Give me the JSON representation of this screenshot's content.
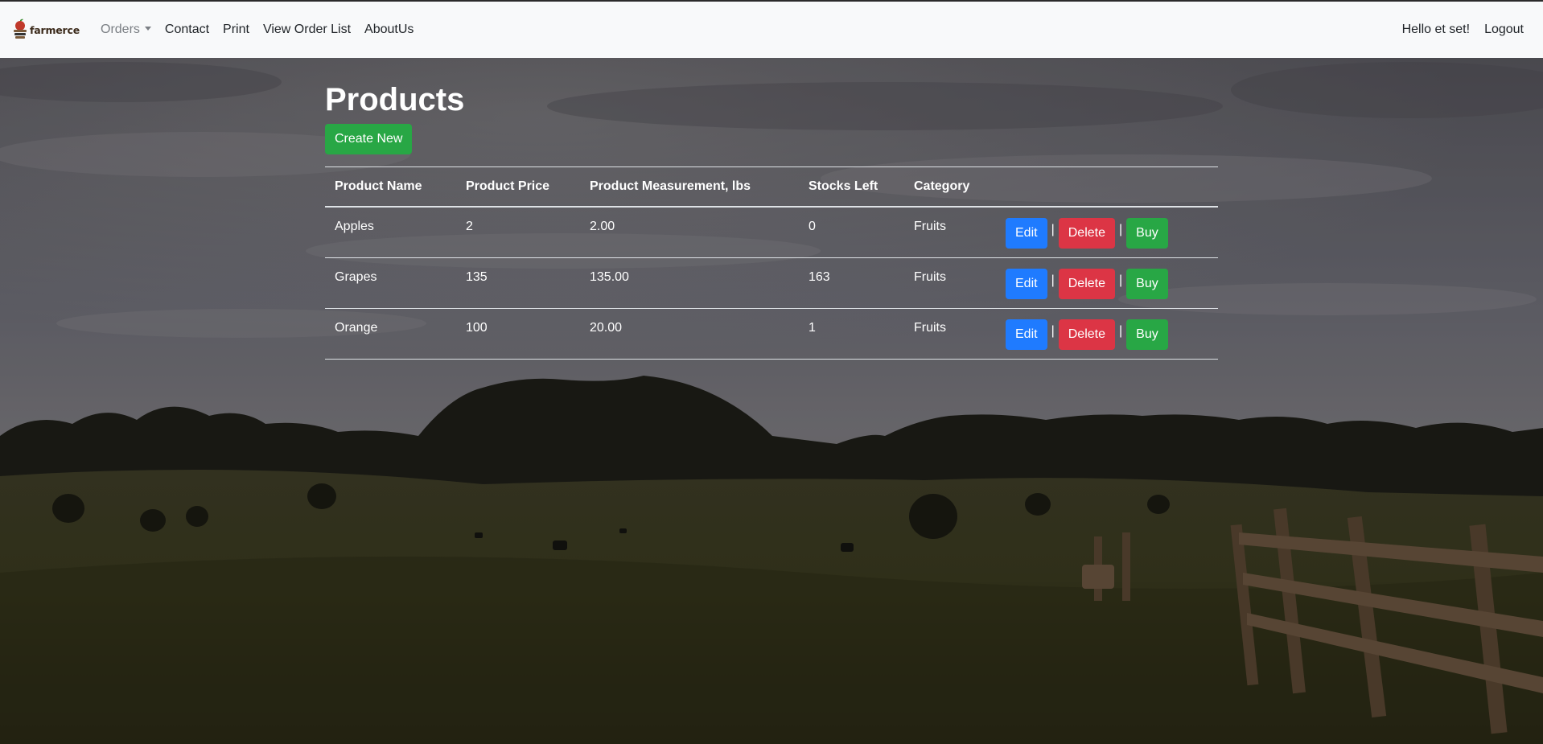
{
  "navbar": {
    "brand_text": "farmerce",
    "links": {
      "orders": "Orders",
      "contact": "Contact",
      "print": "Print",
      "view_order_list": "View Order List",
      "about": "AboutUs"
    },
    "greeting": "Hello et set!",
    "logout": "Logout"
  },
  "page": {
    "title": "Products",
    "create_label": "Create New"
  },
  "table": {
    "headers": [
      "Product Name",
      "Product Price",
      "Product Measurement, lbs",
      "Stocks Left",
      "Category"
    ],
    "rows": [
      {
        "name": "Apples",
        "price": "2",
        "measurement": "2.00",
        "stock": "0",
        "category": "Fruits"
      },
      {
        "name": "Grapes",
        "price": "135",
        "measurement": "135.00",
        "stock": "163",
        "category": "Fruits"
      },
      {
        "name": "Orange",
        "price": "100",
        "measurement": "20.00",
        "stock": "1",
        "category": "Fruits"
      }
    ],
    "actions": {
      "edit": "Edit",
      "delete": "Delete",
      "buy": "Buy",
      "separator": "|"
    }
  },
  "colors": {
    "success": "#28a745",
    "primary": "#1f7bff",
    "danger": "#dc3545",
    "navbar_bg": "#f8f9fa"
  }
}
